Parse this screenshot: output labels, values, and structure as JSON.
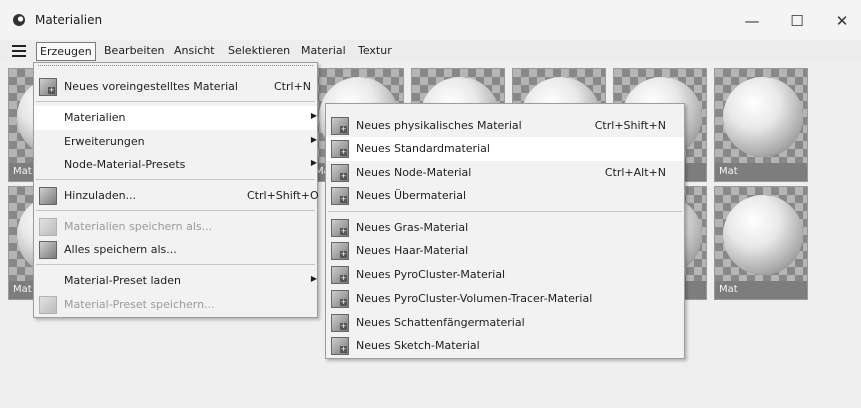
{
  "window": {
    "title": "Materialien",
    "minimize_glyph": "—",
    "maximize_glyph": "☐",
    "close_glyph": "✕"
  },
  "menubar": {
    "items": [
      "Erzeugen",
      "Bearbeiten",
      "Ansicht",
      "Selektieren",
      "Material",
      "Textur"
    ],
    "active": "Erzeugen"
  },
  "materials": {
    "label": "Mat"
  },
  "erzeugen_menu": {
    "items": [
      {
        "label": "Neues voreingestelltes Material",
        "shortcut": "Ctrl+N",
        "icon": "material-preset-icon"
      },
      {
        "label": "Materialien",
        "submenu": true
      },
      {
        "label": "Erweiterungen",
        "submenu": true
      },
      {
        "label": "Node-Material-Presets",
        "submenu": true
      },
      {
        "label": "Hinzuladen...",
        "shortcut": "Ctrl+Shift+O",
        "icon": "load-icon"
      },
      {
        "label": "Materialien speichern als...",
        "disabled": true,
        "icon": "save-materials-icon"
      },
      {
        "label": "Alles speichern als...",
        "icon": "save-all-icon"
      },
      {
        "label": "Material-Preset laden",
        "submenu": true
      },
      {
        "label": "Material-Preset speichern...",
        "disabled": true,
        "icon": "save-preset-icon"
      }
    ]
  },
  "materialien_submenu": {
    "items": [
      {
        "label": "Neues physikalisches Material",
        "shortcut": "Ctrl+Shift+N"
      },
      {
        "label": "Neues Standardmaterial",
        "highlighted": true
      },
      {
        "label": "Neues Node-Material",
        "shortcut": "Ctrl+Alt+N"
      },
      {
        "label": "Neues Übermaterial"
      },
      {
        "label": "Neues Gras-Material"
      },
      {
        "label": "Neues Haar-Material"
      },
      {
        "label": "Neues PyroCluster-Material"
      },
      {
        "label": "Neues PyroCluster-Volumen-Tracer-Material"
      },
      {
        "label": "Neues Schattenfängermaterial"
      },
      {
        "label": "Neues Sketch-Material"
      }
    ]
  }
}
